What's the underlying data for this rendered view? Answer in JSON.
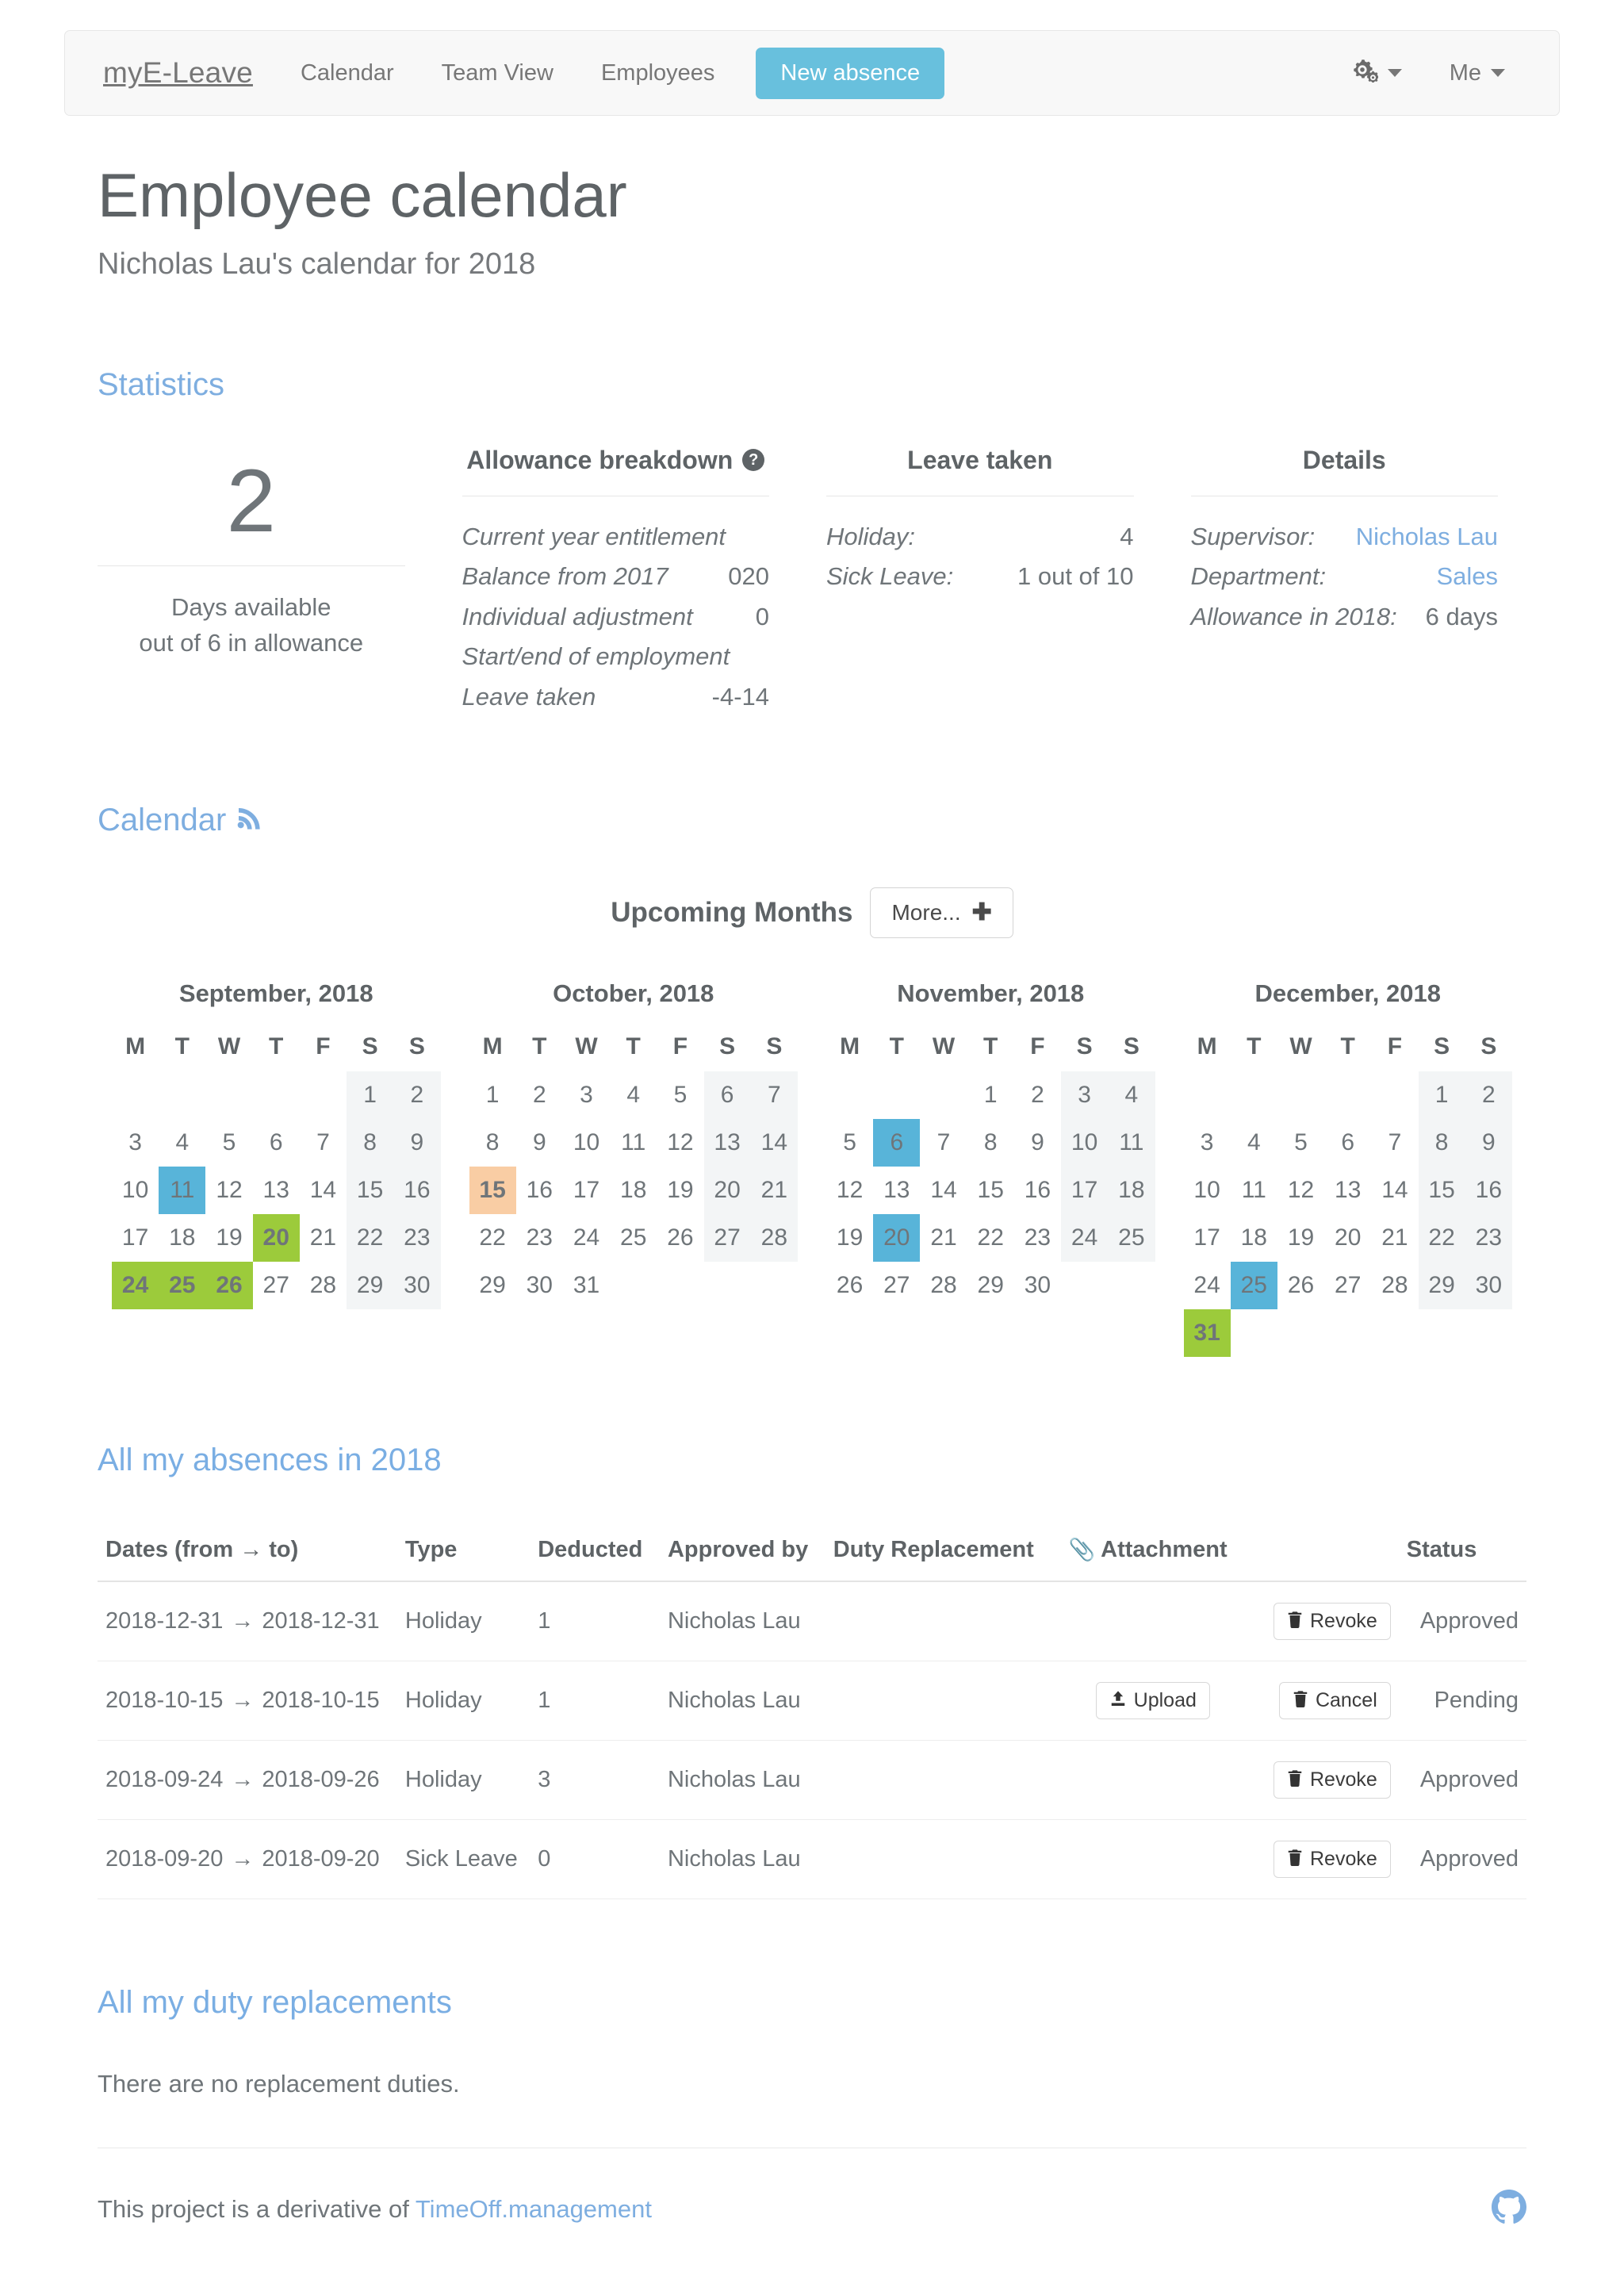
{
  "navbar": {
    "brand": "myE-Leave",
    "links": [
      {
        "label": "Calendar"
      },
      {
        "label": "Team View"
      },
      {
        "label": "Employees"
      }
    ],
    "primary_button": "New absence",
    "primary_button_color": "#68c0dd",
    "settings_icon": "gears-icon",
    "account_label": "Me"
  },
  "header": {
    "title": "Employee calendar",
    "subtitle": "Nicholas Lau's calendar for 2018"
  },
  "statistics": {
    "heading": "Statistics",
    "summary": {
      "big_number": "2",
      "caption_line1": "Days available",
      "caption_line2": "out of 6 in allowance"
    },
    "allowance_breakdown": {
      "title": "Allowance breakdown",
      "help_icon": "question-circle-icon",
      "rows": [
        {
          "label": "Current year entitlement",
          "value": ""
        },
        {
          "label": "Balance from 2017",
          "value": "020"
        },
        {
          "label": "Individual adjustment",
          "value": "0"
        },
        {
          "label": "Start/end of employment",
          "value": ""
        },
        {
          "label": "Leave taken",
          "value": "-4-14"
        }
      ]
    },
    "leave_taken": {
      "title": "Leave taken",
      "rows": [
        {
          "label": "Holiday:",
          "value": "4"
        },
        {
          "label": "Sick Leave:",
          "value": "1 out of 10"
        }
      ]
    },
    "details": {
      "title": "Details",
      "rows": [
        {
          "label": "Supervisor:",
          "value": "Nicholas Lau",
          "link": true
        },
        {
          "label": "Department:",
          "value": "Sales",
          "link": true
        },
        {
          "label": "Allowance in 2018:",
          "value": "6 days",
          "link": false
        }
      ]
    }
  },
  "calendar": {
    "heading": "Calendar",
    "feed_icon": "rss-icon",
    "upcoming_title": "Upcoming Months",
    "more_button": "More...",
    "more_icon": "plus-icon",
    "weekday_headers": [
      "M",
      "T",
      "W",
      "T",
      "F",
      "S",
      "S"
    ],
    "legend_colors": {
      "approved": "#9ccb3b",
      "today": "#58b4d9",
      "pending": "#f9cda4",
      "weekend": "#f3f5f6"
    },
    "months": [
      {
        "title": "September, 2018",
        "first_weekday_index": 5,
        "days_in_month": 30,
        "marks": {
          "11": "today",
          "20": "approved",
          "24": "approved",
          "25": "approved",
          "26": "approved"
        }
      },
      {
        "title": "October, 2018",
        "first_weekday_index": 0,
        "days_in_month": 31,
        "marks": {
          "15": "pending"
        }
      },
      {
        "title": "November, 2018",
        "first_weekday_index": 3,
        "days_in_month": 30,
        "marks": {
          "6": "today",
          "20": "today"
        }
      },
      {
        "title": "December, 2018",
        "first_weekday_index": 5,
        "days_in_month": 31,
        "marks": {
          "25": "today",
          "31": "approved"
        }
      }
    ]
  },
  "absences": {
    "heading": "All my absences in 2018",
    "columns": {
      "dates": "Dates (from → to)",
      "type": "Type",
      "deducted": "Deducted",
      "approved_by": "Approved by",
      "duty_replacement": "Duty Replacement",
      "attachment": "Attachment",
      "attachment_icon": "paperclip-icon",
      "action": "",
      "status": "Status"
    },
    "rows": [
      {
        "date_from": "2018-12-31",
        "arrow": "→",
        "date_to": "2018-12-31",
        "type": "Holiday",
        "deducted": "1",
        "approved_by": "Nicholas Lau",
        "duty_replacement": "",
        "attachment_button": "",
        "action_button": "Revoke",
        "action_icon": "trash-icon",
        "status": "Approved"
      },
      {
        "date_from": "2018-10-15",
        "arrow": "→",
        "date_to": "2018-10-15",
        "type": "Holiday",
        "deducted": "1",
        "approved_by": "Nicholas Lau",
        "duty_replacement": "",
        "attachment_button": "Upload",
        "attachment_icon": "upload-icon",
        "action_button": "Cancel",
        "action_icon": "trash-icon",
        "status": "Pending"
      },
      {
        "date_from": "2018-09-24",
        "arrow": "→",
        "date_to": "2018-09-26",
        "type": "Holiday",
        "deducted": "3",
        "approved_by": "Nicholas Lau",
        "duty_replacement": "",
        "attachment_button": "",
        "action_button": "Revoke",
        "action_icon": "trash-icon",
        "status": "Approved"
      },
      {
        "date_from": "2018-09-20",
        "arrow": "→",
        "date_to": "2018-09-20",
        "type": "Sick Leave",
        "deducted": "0",
        "approved_by": "Nicholas Lau",
        "duty_replacement": "",
        "attachment_button": "",
        "action_button": "Revoke",
        "action_icon": "trash-icon",
        "status": "Approved"
      }
    ]
  },
  "duty_replacements": {
    "heading": "All my duty replacements",
    "empty_text": "There are no replacement duties."
  },
  "footer": {
    "text_prefix": "This project is a derivative of ",
    "link_label": "TimeOff.management",
    "github_icon": "github-icon",
    "link_color": "#7eaee0"
  }
}
